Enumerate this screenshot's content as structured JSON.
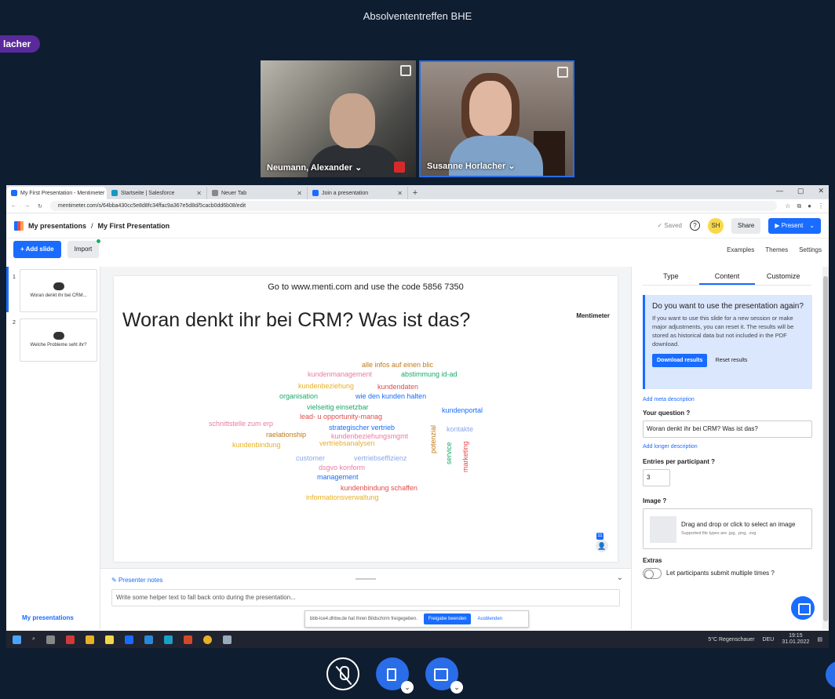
{
  "meeting": {
    "title": "Absolvententreffen BHE",
    "presenter_badge": "lacher",
    "participants": [
      {
        "name": "Neumann, Alexander ⌄"
      },
      {
        "name": "Susanne Horlacher ⌄"
      }
    ]
  },
  "browser": {
    "tabs": [
      {
        "label": "My First Presentation - Mentimeter",
        "color": "#196cff"
      },
      {
        "label": "Startseite | Salesforce",
        "color": "#1798c1"
      },
      {
        "label": "Neuer Tab",
        "color": "#888888"
      },
      {
        "label": "Join a presentation",
        "color": "#196cff"
      }
    ],
    "new_tab": "+",
    "url": "mentimeter.com/s/64bba430cc5e8d8fc34ffac9a367e5d8d/5cacb0dd6b08/edit"
  },
  "app": {
    "breadcrumb_root": "My presentations",
    "breadcrumb_sep": "/",
    "breadcrumb_current": "My First Presentation",
    "saved": "✓ Saved",
    "help": "?",
    "avatar": "SH",
    "share": "Share",
    "present": "▶ Present",
    "add_slide": "+ Add slide",
    "import": "Import",
    "examples": "Examples",
    "themes": "Themes",
    "settings": "Settings",
    "my_presentations": "My presentations"
  },
  "slides": [
    {
      "num": "1",
      "title": "Woran denkt ihr bei CRM..."
    },
    {
      "num": "2",
      "title": "Welche Probleme seht ihr?"
    }
  ],
  "slide": {
    "code_text": "Go to www.menti.com and use the code 5856 7350",
    "question": "Woran denkt ihr bei CRM? Was ist das?",
    "brand": "Mentimeter",
    "count": "11"
  },
  "wordcloud": [
    {
      "text": "alle infos auf einen blic",
      "color": "#c27a17"
    },
    {
      "text": "kundenmanagement",
      "color": "#e87ca4"
    },
    {
      "text": "abstimmung id-ad",
      "color": "#1aaa6b"
    },
    {
      "text": "kundenbeziehung",
      "color": "#e8b026"
    },
    {
      "text": "kundendaten",
      "color": "#e14c4c"
    },
    {
      "text": "organisation",
      "color": "#1aaa6b"
    },
    {
      "text": "wie den kunden halten",
      "color": "#196cff"
    },
    {
      "text": "vielseitig einsetzbar",
      "color": "#1aaa6b"
    },
    {
      "text": "kundenportal",
      "color": "#196cff"
    },
    {
      "text": "lead- u opportunity-manag",
      "color": "#e14c4c"
    },
    {
      "text": "schnittstelle zum erp",
      "color": "#e87ca4"
    },
    {
      "text": "strategischer vertrieb",
      "color": "#196cff"
    },
    {
      "text": "kontakte",
      "color": "#8aa8e8"
    },
    {
      "text": "raelationship",
      "color": "#c27a17"
    },
    {
      "text": "kundenbeziehungsmgmt",
      "color": "#e87ca4"
    },
    {
      "text": "kundenbindung",
      "color": "#e8b026"
    },
    {
      "text": "vertriebsanalysen",
      "color": "#e8b026"
    },
    {
      "text": "customer",
      "color": "#8aa8e8"
    },
    {
      "text": "vertriebseffizienz",
      "color": "#8aa8e8"
    },
    {
      "text": "dsgvo konform",
      "color": "#e87ca4"
    },
    {
      "text": "management",
      "color": "#196cff"
    },
    {
      "text": "kundenbindung schaffen",
      "color": "#e14c4c"
    },
    {
      "text": "informationsverwaltung",
      "color": "#e8b026"
    },
    {
      "text": "potenzial",
      "color": "#c27a17"
    },
    {
      "text": "service",
      "color": "#1aaa6b"
    },
    {
      "text": "marketing",
      "color": "#e14c4c"
    }
  ],
  "notes": {
    "label": "Presenter notes",
    "placeholder": "Write some helper text to fall back onto during the presentation..."
  },
  "panel": {
    "tabs": [
      "Type",
      "Content",
      "Customize"
    ],
    "info_title": "Do you want to use the presentation again?",
    "info_text": "If you want to use this slide for a new session or make major adjustments, you can reset it. The results will be stored as historical data but not included in the PDF download.",
    "download": "Download results",
    "reset": "Reset results",
    "meta_link": "Add meta description",
    "question_label": "Your question",
    "question_value": "Woran denkt ihr bei CRM? Was ist das?",
    "longer_link": "Add longer description",
    "entries_label": "Entries per participant",
    "entries_value": "3",
    "image_label": "Image",
    "image_drop": "Drag and drop or click to select an image",
    "image_types": "Supported file types are .jpg, .png, .svg",
    "extras_label": "Extras",
    "extras_option": "Let participants submit multiple times",
    "q": "?"
  },
  "sharebar": {
    "text": "bbb-lce4.dhbw.de hat Ihren Bildschirm freigegeben.",
    "stop": "Freigabe beenden",
    "hide": "Ausblenden"
  },
  "taskbar": {
    "weather": "5°C Regenschauer",
    "lang": "DEU",
    "time": "19:15",
    "date": "31.01.2022"
  }
}
